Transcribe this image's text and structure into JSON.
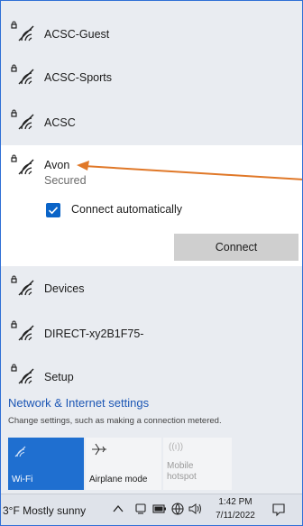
{
  "networks_top": [
    {
      "name": "ACSC-Guest"
    },
    {
      "name": "ACSC-Sports"
    },
    {
      "name": "ACSC"
    }
  ],
  "expanded_network": {
    "name": "Avon",
    "status": "Secured",
    "connect_automatically_label": "Connect automatically",
    "connect_automatically_checked": true,
    "connect_button": "Connect"
  },
  "networks_bottom": [
    {
      "name": "Devices"
    },
    {
      "name": "DIRECT-xy2B1F75-"
    },
    {
      "name": "Setup"
    }
  ],
  "settings": {
    "title": "Network & Internet settings",
    "subtitle": "Change settings, such as making a connection metered."
  },
  "quick_actions": [
    {
      "label": "Wi-Fi",
      "active": true,
      "icon": "wifi-icon"
    },
    {
      "label": "Airplane mode",
      "active": false,
      "icon": "airplane-icon"
    },
    {
      "label": "Mobile hotspot",
      "active": false,
      "disabled": true,
      "icon": "hotspot-icon"
    }
  ],
  "taskbar": {
    "weather": "3°F Mostly sunny",
    "time": "1:42 PM",
    "date": "7/11/2022"
  },
  "colors": {
    "accent": "#0a64c8",
    "link": "#1d57b5",
    "arrow": "#e07828",
    "frame_border": "#2f6fd6"
  }
}
